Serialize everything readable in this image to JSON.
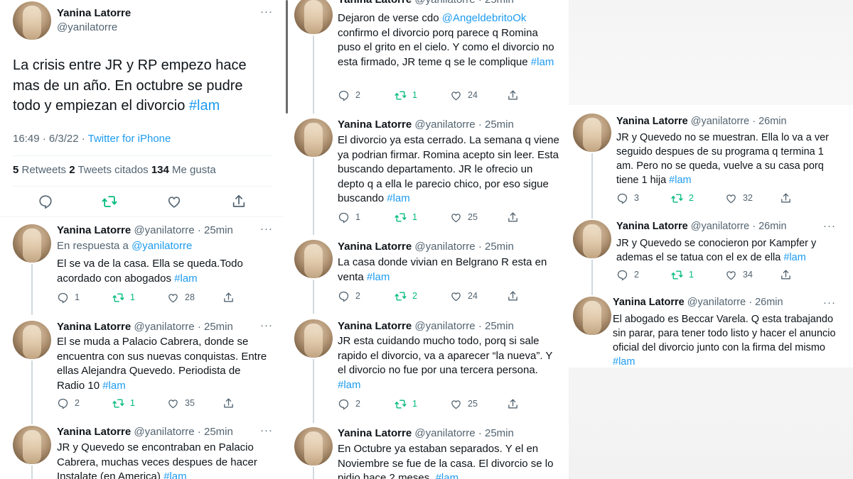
{
  "author": {
    "name": "Yanina Latorre",
    "handle": "@yanilatorre",
    "more": "···"
  },
  "main": {
    "text_a": "La crisis entre JR y RP empezo hace mas de un año. En octubre se pudre todo y empiezan el divorcio ",
    "tag": "#lam",
    "time": "16:49 · 6/3/22 · ",
    "source": "Twitter for iPhone",
    "stats": {
      "retweets": "5",
      "retweets_label": " Retweets  ",
      "quotes": "2",
      "quotes_label": " Tweets citados  ",
      "likes": "134",
      "likes_label": " Me gusta"
    }
  },
  "tweets": [
    {
      "time": "· 25min",
      "reply_prefix": "En respuesta a ",
      "reply_to": "@yanilatorre",
      "text": "El se va de la casa. Ella se queda.Todo acordado con abogados ",
      "tag": "#lam",
      "replies": "1",
      "retweets": "1",
      "likes": "28"
    },
    {
      "time": "· 25min",
      "text": "El se muda a Palacio Cabrera, donde se encuentra con sus nuevas conquistas. Entre ellas Alejandra Quevedo. Periodista de Radio 10 ",
      "tag": "#lam",
      "replies": "2",
      "retweets": "1",
      "likes": "35"
    },
    {
      "time": "· 25min",
      "text": "JR y Quevedo se encontraban en Palacio Cabrera, muchas veces despues de hacer Instalate (en America) ",
      "tag": "#lam"
    },
    {
      "time": "· 25min",
      "text_a": "Dejaron de verse cdo ",
      "mention": "@AngeldebritoOk",
      "text": " confirmo el divorcio porq parece q Romina puso el grito en el cielo. Y como el divorcio no esta firmado, JR teme q se le complique ",
      "tag": "#lam",
      "replies": "2",
      "retweets": "1",
      "likes": "24"
    },
    {
      "time": "· 25min",
      "text": "El divorcio ya esta cerrado. La semana q viene ya podrian firmar. Romina acepto sin leer. Esta buscando departamento. JR le ofrecio un depto q a ella le parecio chico, por eso sigue buscando ",
      "tag": "#lam",
      "replies": "1",
      "retweets": "1",
      "likes": "25"
    },
    {
      "time": "· 25min",
      "text": "La casa donde vivian en Belgrano R esta en venta ",
      "tag": "#lam",
      "replies": "2",
      "retweets": "2",
      "likes": "24"
    },
    {
      "time": "· 25min",
      "text": "JR esta cuidando mucho todo, porq si sale rapido el divorcio, va a aparecer “la nueva”. Y el divorcio no fue por una tercera persona. ",
      "tag": "#lam",
      "replies": "2",
      "retweets": "1",
      "likes": "25"
    },
    {
      "time": "· 25min",
      "text": "En Octubre ya estaban separados. Y el en Noviembre se fue de la casa. El divorcio se lo pidio hace 2 meses. ",
      "tag": "#lam"
    },
    {
      "time": "· 26min",
      "text": "JR y Quevedo no se muestran. Ella lo va a ver seguido despues de su programa q termina 1 am. Pero no se queda, vuelve a su casa porq tiene 1 hija ",
      "tag": "#lam",
      "replies": "3",
      "retweets": "2",
      "likes": "32"
    },
    {
      "time": "· 26min",
      "text": "JR y Quevedo se conocieron por Kampfer y ademas el se tatua con el ex de ella ",
      "tag": "#lam",
      "replies": "2",
      "retweets": "1",
      "likes": "34"
    },
    {
      "time": "· 26min",
      "text": "El abogado es Beccar Varela. Q esta trabajando sin parar, para tener todo listo y hacer el anuncio oficial del divorcio junto con la firma del mismo ",
      "tag": "#lam"
    }
  ],
  "icons": [
    "reply-icon",
    "retweet-icon",
    "like-icon",
    "share-icon"
  ],
  "colors": {
    "accent": "#1d9bf0",
    "retweet": "#00ba7c",
    "muted": "#536471",
    "text": "#0f1419"
  }
}
